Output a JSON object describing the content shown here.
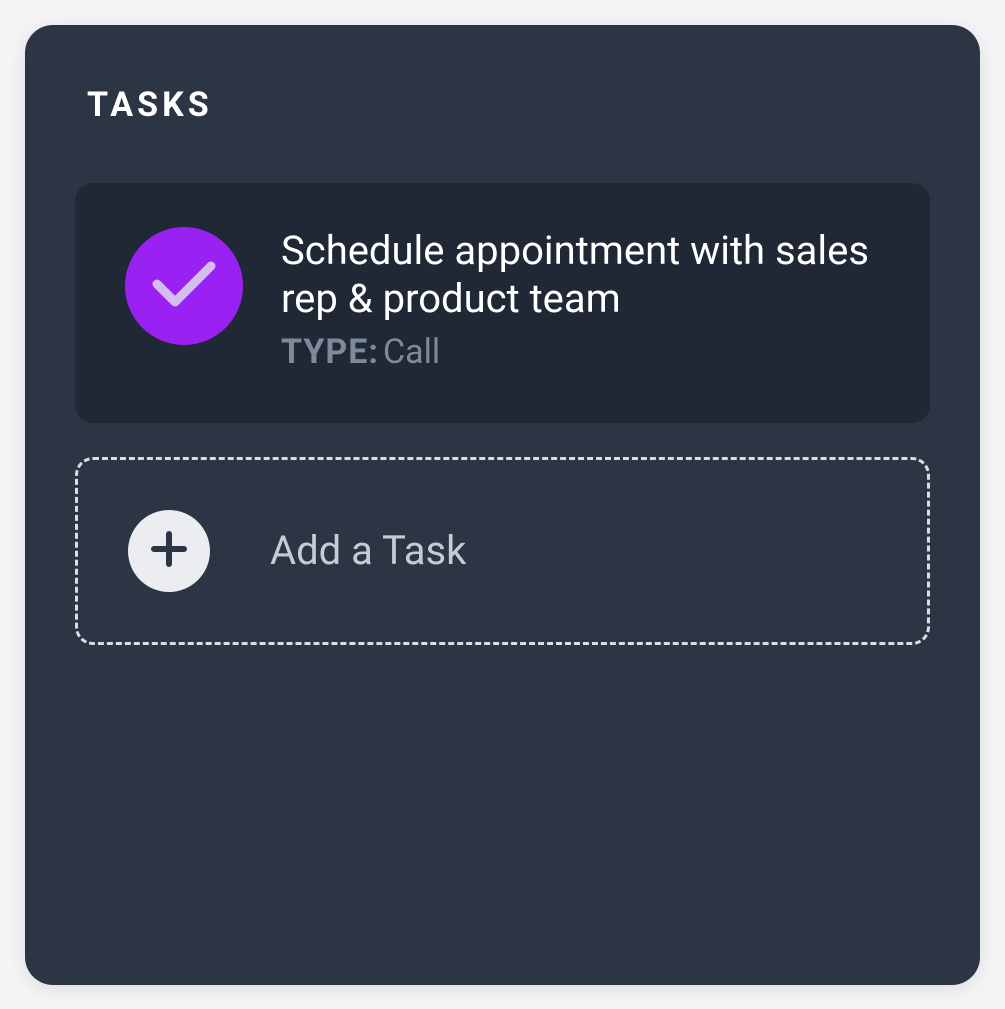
{
  "panel": {
    "title": "TASKS"
  },
  "tasks": [
    {
      "title": "Schedule appointment with sales rep & product team",
      "type_label": "TYPE:",
      "type_value": "Call",
      "completed": true
    }
  ],
  "add_task": {
    "label": "Add a Task"
  },
  "colors": {
    "panel_bg": "#2b3544",
    "card_bg": "#1f2834",
    "accent": "#9921f2",
    "text_primary": "#ffffff",
    "text_muted": "#7e8a9a",
    "border_dashed": "#d9dee4"
  }
}
